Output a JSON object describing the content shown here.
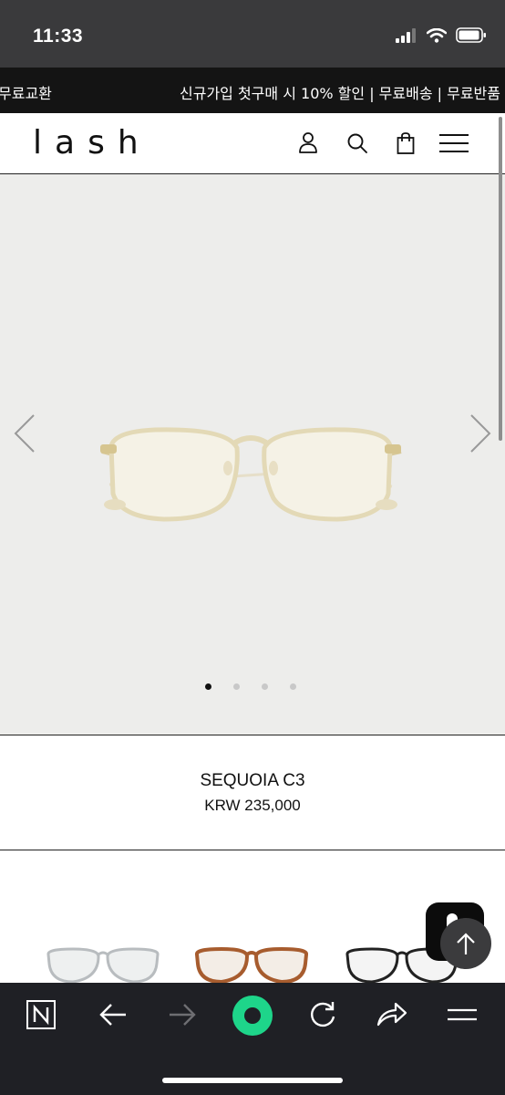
{
  "status_bar": {
    "time": "11:33"
  },
  "promo_banner": {
    "left_text": "무료교환",
    "main_text": "신규가입 첫구매 시 10% 할인 | 무료배송 | 무료반품"
  },
  "header": {
    "logo": "lash"
  },
  "hero": {
    "slide_count": 4,
    "active_slide": 1
  },
  "product": {
    "name": "SEQUOIA C3",
    "price": "KRW 235,000"
  },
  "colors": {
    "status_bg": "#3a3a3c",
    "promo_bg": "#141414",
    "hero_bg": "#ededeb",
    "toolbar_bg": "#1f2025",
    "accent_green": "#1ed58a"
  },
  "icons": [
    "user-icon",
    "search-icon",
    "bag-icon",
    "menu-icon",
    "prev-arrow-icon",
    "next-arrow-icon",
    "scroll-top-icon",
    "n-logo-icon",
    "back-icon",
    "forward-icon",
    "home-orb-icon",
    "reload-icon",
    "share-icon",
    "tabs-menu-icon"
  ]
}
